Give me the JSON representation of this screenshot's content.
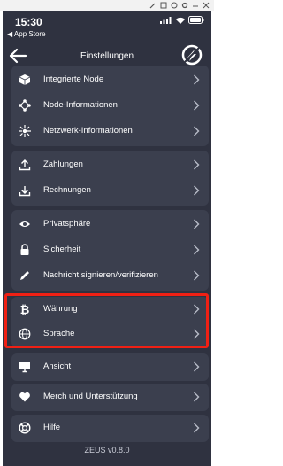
{
  "statusbar": {
    "time": "15:30",
    "back_app": "◀ App Store"
  },
  "header": {
    "title": "Einstellungen"
  },
  "groups": [
    {
      "items": [
        {
          "label": "Integrierte Node",
          "icon": "cube-icon"
        },
        {
          "label": "Node-Informationen",
          "icon": "node-network-icon"
        },
        {
          "label": "Netzwerk-Informationen",
          "icon": "network-icon"
        }
      ]
    },
    {
      "items": [
        {
          "label": "Zahlungen",
          "icon": "upload-icon"
        },
        {
          "label": "Rechnungen",
          "icon": "download-icon"
        }
      ]
    },
    {
      "items": [
        {
          "label": "Privatsphäre",
          "icon": "eye-icon"
        },
        {
          "label": "Sicherheit",
          "icon": "lock-icon"
        },
        {
          "label": "Nachricht signieren/verifizieren",
          "icon": "pen-icon"
        }
      ]
    },
    {
      "items": [
        {
          "label": "Währung",
          "icon": "bitcoin-icon"
        },
        {
          "label": "Sprache",
          "icon": "globe-icon"
        }
      ]
    },
    {
      "items": [
        {
          "label": "Ansicht",
          "icon": "display-icon"
        }
      ]
    },
    {
      "items": [
        {
          "label": "Merch und Unterstützung",
          "icon": "heart-icon"
        }
      ]
    },
    {
      "items": [
        {
          "label": "Hilfe",
          "icon": "lifebuoy-icon"
        }
      ]
    }
  ],
  "footer": {
    "version": "ZEUS v0.8.0"
  },
  "colors": {
    "background": "#2f3240",
    "card": "#3b3f4e",
    "highlight": "#f02014"
  }
}
